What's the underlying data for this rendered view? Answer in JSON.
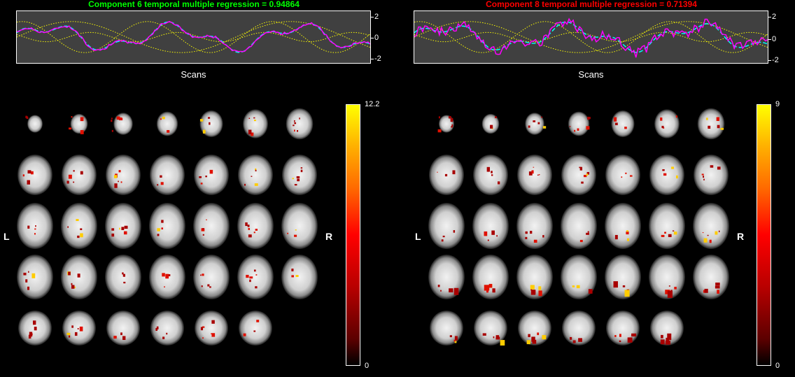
{
  "panels": [
    {
      "title": "Component 6 temporal multiple regression = 0.94864",
      "title_color": "#00ff00",
      "xlabel": "Scans",
      "yticks": [
        "2",
        "0",
        "-2"
      ],
      "colorbar": {
        "max": "12.2",
        "min": "0"
      },
      "side_labels": {
        "left": "L",
        "right": "R"
      },
      "row_counts": [
        7,
        7,
        7,
        7,
        6
      ]
    },
    {
      "title": "Component 8 temporal multiple regression = 0.71394",
      "title_color": "#ff0000",
      "xlabel": "Scans",
      "yticks": [
        "2",
        "0",
        "-2"
      ],
      "colorbar": {
        "max": "9",
        "min": "0"
      },
      "side_labels": {
        "left": "L",
        "right": "R"
      },
      "row_counts": [
        7,
        7,
        7,
        7,
        6
      ]
    }
  ],
  "colors": {
    "background": "#000000",
    "plot_background": "#404040",
    "component_line": "#ff00ff",
    "fit_line": "#00ffff",
    "regressor_line": "#ffff00",
    "colormap": "hot"
  }
}
